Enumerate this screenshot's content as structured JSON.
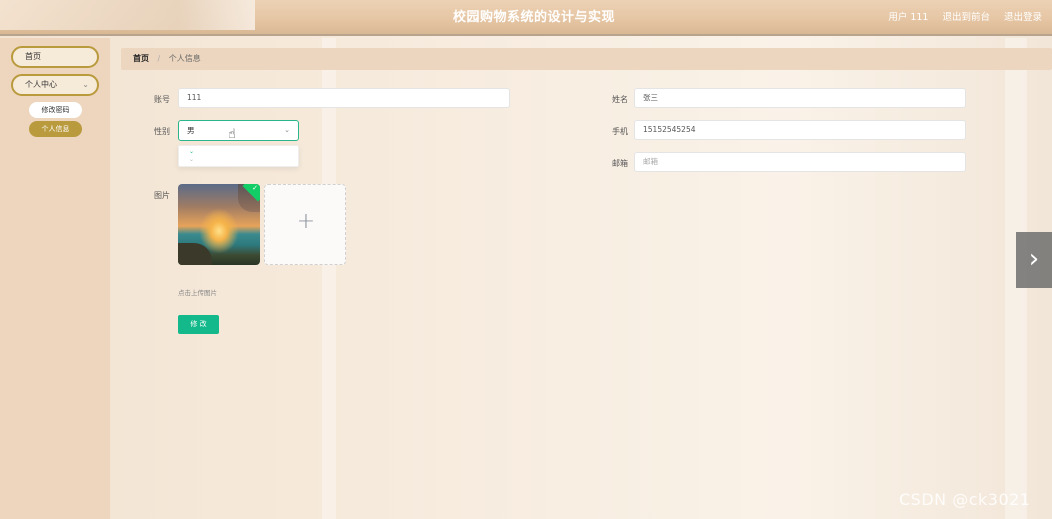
{
  "header": {
    "title": "校园购物系统的设计与实现",
    "user_label": "用户 111",
    "back_label": "退出到前台",
    "logout_label": "退出登录"
  },
  "sidebar": {
    "home": "首页",
    "personal_center": "个人中心",
    "change_password": "修改密码",
    "personal_info": "个人信息"
  },
  "breadcrumb": {
    "home": "首页",
    "separator": "/",
    "current": "个人信息"
  },
  "form": {
    "account": {
      "label": "账号",
      "value": "111"
    },
    "name": {
      "label": "姓名",
      "value": "张三"
    },
    "gender": {
      "label": "性别",
      "value": "男"
    },
    "phone": {
      "label": "手机",
      "value": "15152545254"
    },
    "email": {
      "label": "邮箱",
      "placeholder": "邮箱"
    },
    "image": {
      "label": "图片"
    },
    "upload_tip": "点击上传图片",
    "submit_label": "修 改"
  },
  "watermark": "CSDN @ck3021",
  "colors": {
    "accent": "#b99a3d",
    "primary_button": "#13b98a",
    "select_border": "#2bb58a",
    "success_badge": "#13ce66"
  }
}
